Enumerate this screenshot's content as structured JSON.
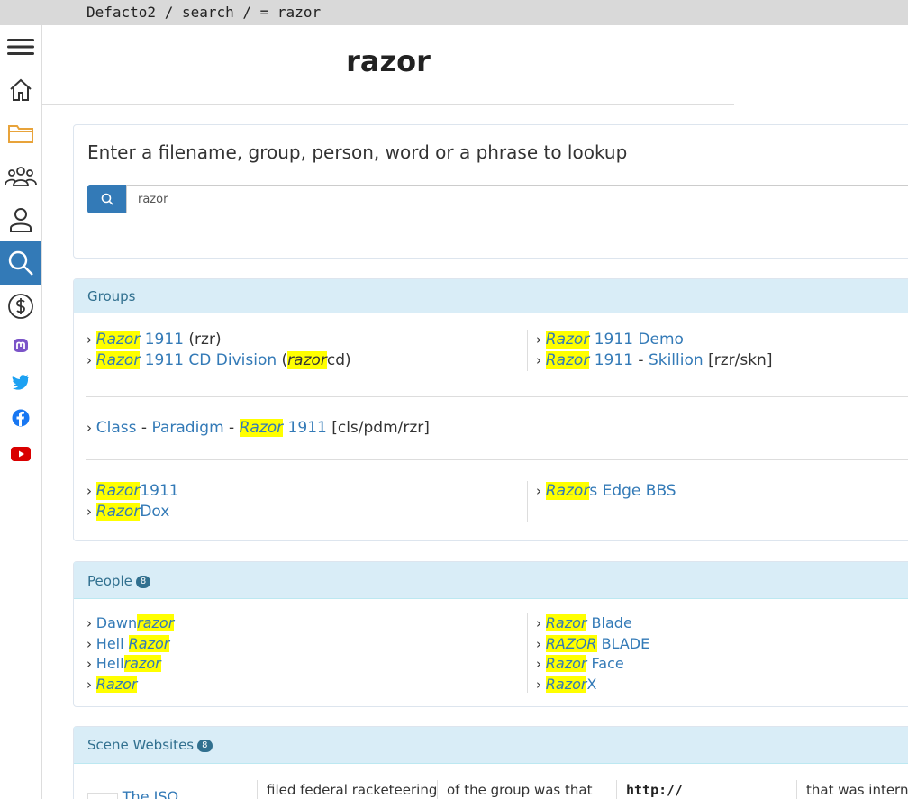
{
  "topbar": {
    "path": "Defacto2 / search / = razor"
  },
  "sidebar": {
    "items": [
      {
        "icon": "hamburger-menu-icon"
      },
      {
        "icon": "home-icon"
      },
      {
        "icon": "folder-icon"
      },
      {
        "icon": "groups-icon"
      },
      {
        "icon": "person-icon"
      },
      {
        "icon": "search-icon"
      },
      {
        "icon": "dollar-icon"
      },
      {
        "icon": "mastodon-icon"
      },
      {
        "icon": "twitter-icon"
      },
      {
        "icon": "facebook-icon"
      },
      {
        "icon": "youtube-icon"
      }
    ]
  },
  "page": {
    "title": "razor"
  },
  "search": {
    "prompt": "Enter a filename, group, person, word or a phrase to lookup",
    "value": "razor"
  },
  "groups": {
    "heading": "Groups",
    "row1": {
      "left": [
        {
          "hl": "Razor",
          "rest": " 1911",
          "extra": " (rzr)"
        },
        {
          "hl": "Razor",
          "rest": " 1911 CD Division",
          "extra_pre": " (",
          "extra_hl": "razor",
          "extra_post": "cd)"
        }
      ],
      "right": [
        {
          "hl": "Razor",
          "rest": " 1911 Demo"
        },
        {
          "hl": "Razor",
          "rest": " 1911",
          "sep": " - ",
          "rest2": "Skillion",
          "extra": " [rzr/skn]"
        }
      ]
    },
    "row2": {
      "a": "Class",
      "sep1": " - ",
      "b": "Paradigm",
      "sep2": " - ",
      "hl": "Razor",
      "rest": " 1911",
      "extra": " [cls/pdm/rzr]"
    },
    "row3": {
      "left": [
        {
          "hl": "Razor",
          "rest": "1911"
        },
        {
          "hl": "Razor",
          "rest": "Dox"
        }
      ],
      "right": [
        {
          "hl": "Razor",
          "rest": "s Edge BBS"
        }
      ]
    }
  },
  "people": {
    "heading": "People",
    "count": "8",
    "left": [
      {
        "pre": "Dawn",
        "hl": "razor",
        "post": ""
      },
      {
        "pre": "Hell ",
        "hl": "Razor",
        "post": ""
      },
      {
        "pre": "Hell",
        "hl": "razor",
        "post": ""
      },
      {
        "pre": "",
        "hl": "Razor",
        "post": ""
      }
    ],
    "right": [
      {
        "pre": "",
        "hl": "Razor",
        "post": " Blade"
      },
      {
        "pre": "",
        "hl": "RAZOR",
        "post": " BLADE"
      },
      {
        "pre": "",
        "hl": "Razor",
        "post": " Face"
      },
      {
        "pre": "",
        "hl": "Razor",
        "post": "X"
      }
    ]
  },
  "websites": {
    "heading": "Scene Websites",
    "count": "8",
    "cols": [
      {
        "text": "The ISO..."
      },
      {
        "text": "filed federal racketeering"
      },
      {
        "text": "of the group was that"
      },
      {
        "text": "http://"
      },
      {
        "text": "that was internal"
      }
    ]
  },
  "colors": {
    "accent": "#337ab7",
    "highlight": "#ffff00",
    "panel": "#d9edf7"
  }
}
